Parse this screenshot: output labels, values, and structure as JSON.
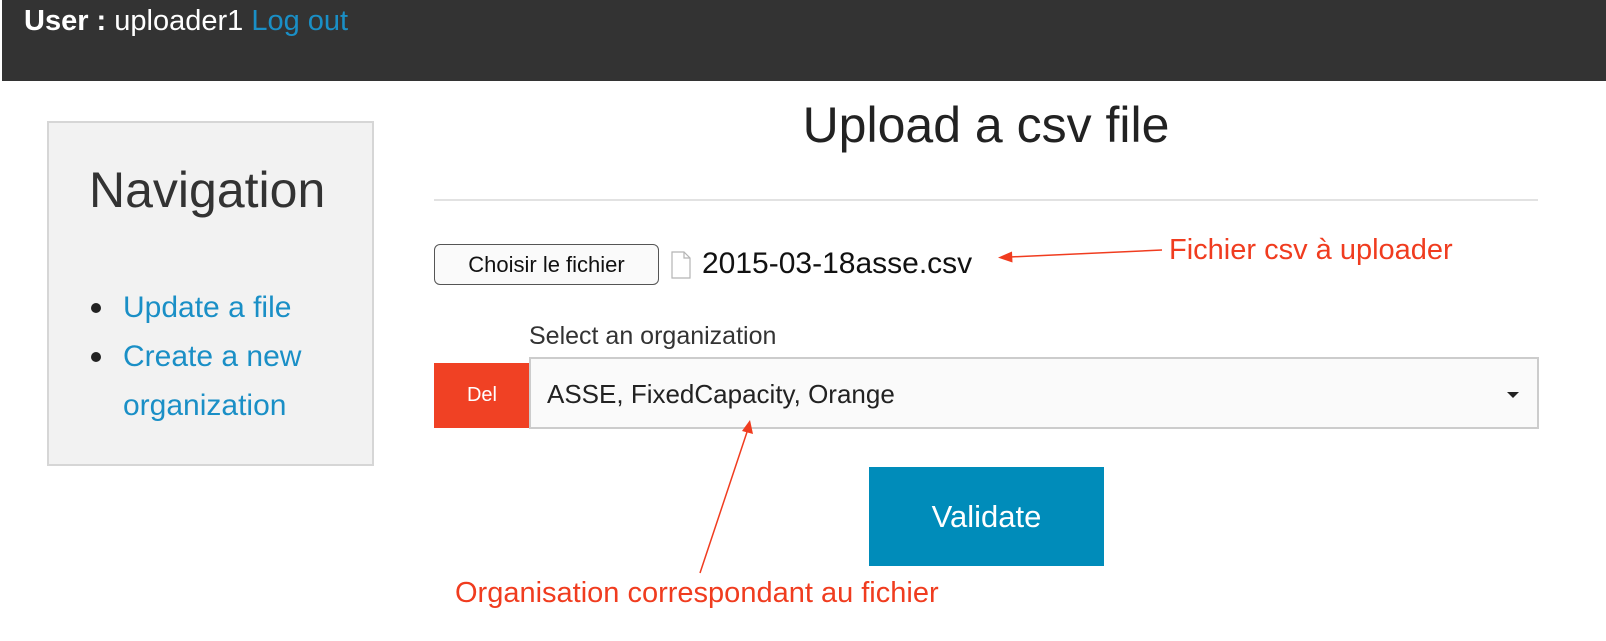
{
  "header": {
    "user_label": "User :",
    "username": "uploader1",
    "logout_label": "Log out"
  },
  "navigation": {
    "title": "Navigation",
    "items": [
      {
        "label": "Update a file"
      },
      {
        "label": "Create a new organization"
      }
    ]
  },
  "main": {
    "title": "Upload a csv file",
    "file": {
      "button_label": "Choisir le fichier",
      "filename": "2015-03-18asse.csv",
      "icon": "document-icon"
    },
    "organization": {
      "label": "Select an organization",
      "del_label": "Del",
      "selected": "ASSE, FixedCapacity, Orange",
      "icon": "chevron-down-icon"
    },
    "validate_label": "Validate"
  },
  "annotations": {
    "file_note": "Fichier csv à uploader",
    "org_note": "Organisation correspondant au fichier"
  },
  "colors": {
    "topbar": "#333333",
    "link": "#1a8fc6",
    "delete": "#f04124",
    "primary": "#008cba",
    "annotation": "#f03c1f"
  }
}
